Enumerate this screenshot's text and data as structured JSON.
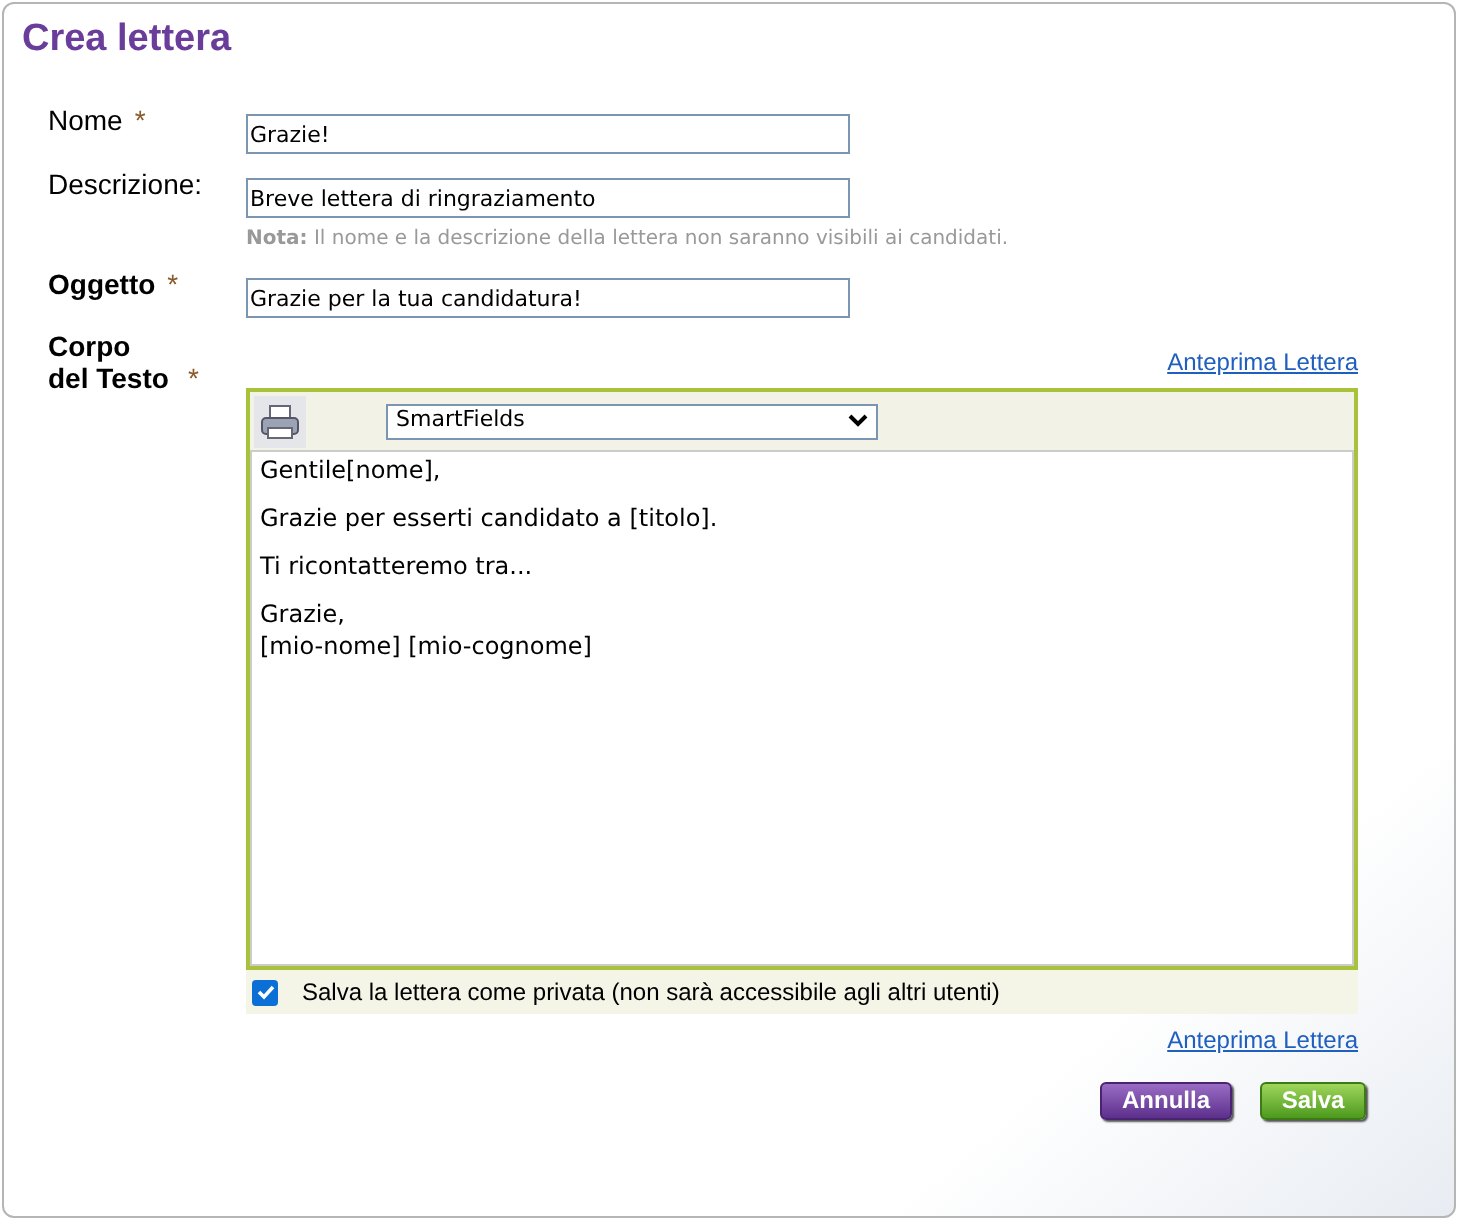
{
  "title": "Crea lettera",
  "fields": [
    {
      "label": "Nome",
      "required_mark": "*",
      "emphasized": false,
      "value": "Grazie!"
    },
    {
      "label": "Descrizione:",
      "emphasized": false,
      "value": "Breve lettera di ringraziamento",
      "note": "**Nota:** Il nome e la descrizione della lettera non saranno visibili ai candidati."
    },
    {
      "label": "Oggetto",
      "required_mark": "*",
      "emphasized": true,
      "value": "Grazie per la tua candidatura!"
    }
  ],
  "body": {
    "label": "Corpo del Testo",
    "required_mark": "*",
    "preview_link_top": "Anteprima Lettera",
    "smartfields": "SmartFields",
    "paragraphs": [
      [
        "Gentile[nome],"
      ],
      [
        "Grazie per esserti candidato a [titolo]."
      ],
      [
        "Ti ricontatteremo tra..."
      ],
      [
        "Grazie,",
        "[mio-nome] [mio-cognome]"
      ]
    ],
    "private": {
      "label": "Salva la lettera come privata (non sarà accessibile agli altri utenti)",
      "checked": true
    },
    "preview_link_bottom": "Anteprima Lettera"
  },
  "buttons": [
    {
      "label": "Annulla",
      "kind": "cancel"
    },
    {
      "label": "Salva",
      "kind": "save"
    }
  ]
}
